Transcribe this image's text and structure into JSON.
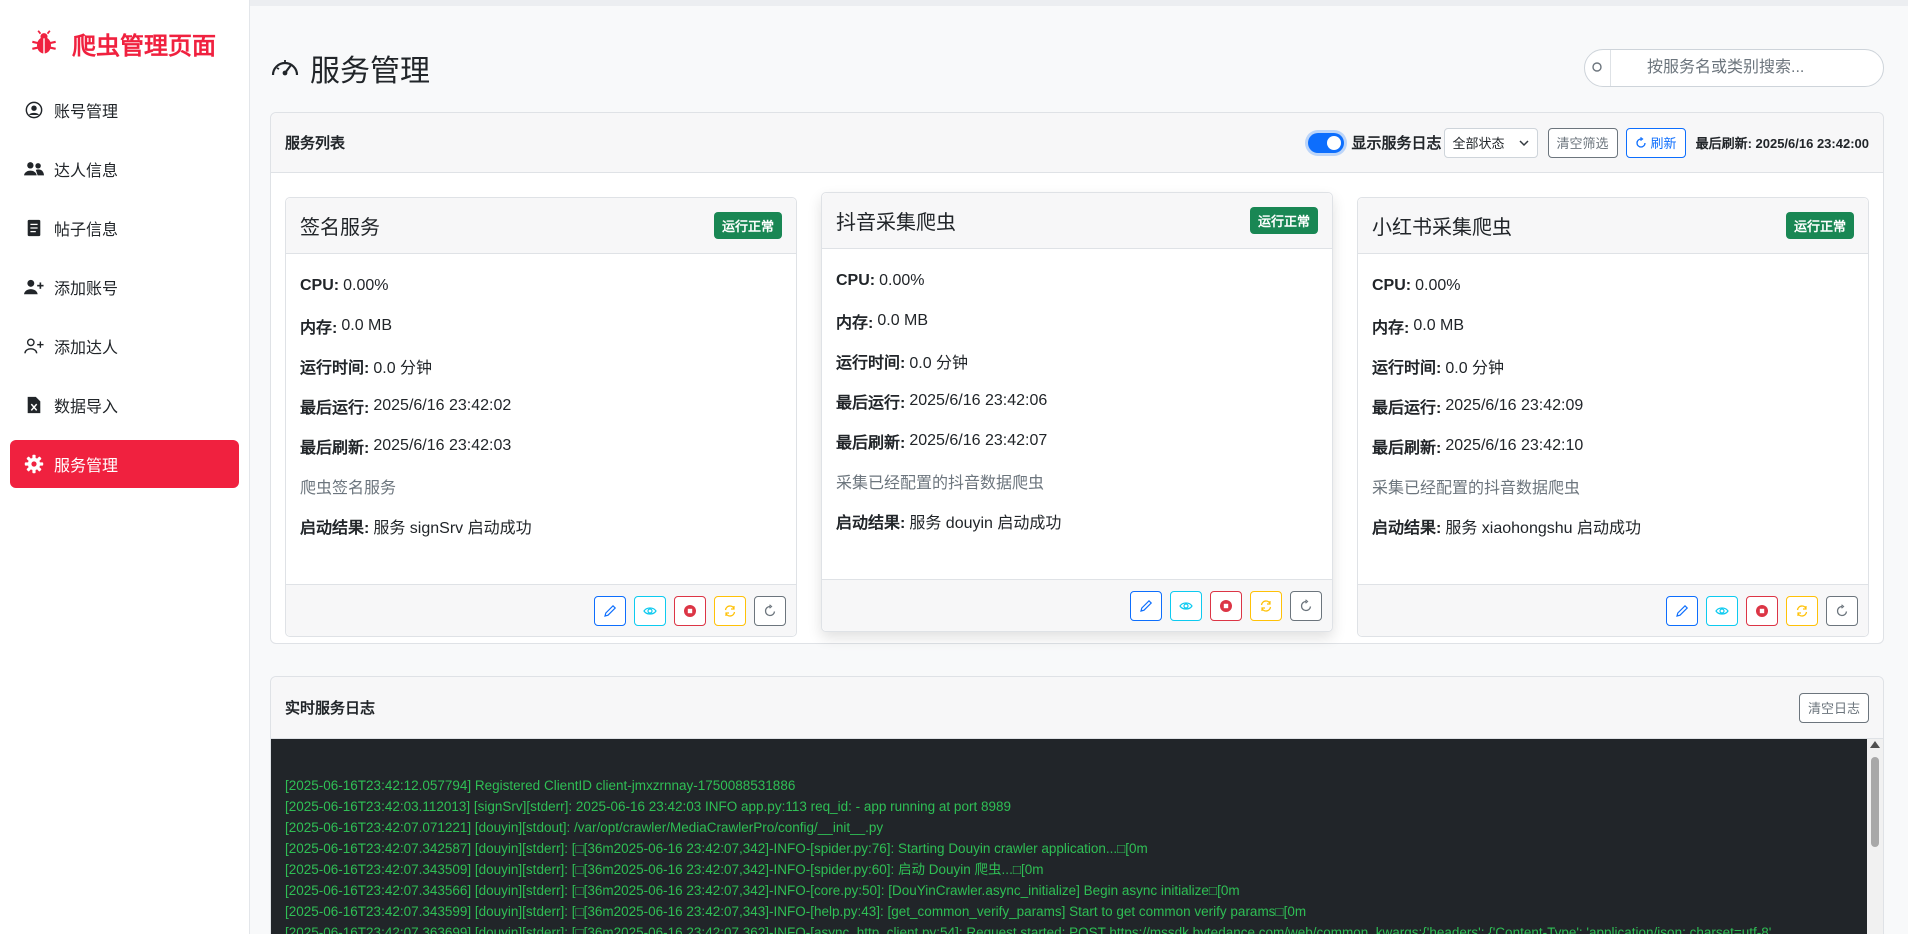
{
  "sidebar": {
    "brand": "爬虫管理页面",
    "items": [
      {
        "label": "账号管理",
        "icon": "user-circle-icon"
      },
      {
        "label": "达人信息",
        "icon": "users-icon"
      },
      {
        "label": "帖子信息",
        "icon": "document-icon"
      },
      {
        "label": "添加账号",
        "icon": "user-plus-icon"
      },
      {
        "label": "添加达人",
        "icon": "user-add-outline-icon"
      },
      {
        "label": "数据导入",
        "icon": "excel-file-icon"
      },
      {
        "label": "服务管理",
        "icon": "gear-icon",
        "active": true
      }
    ]
  },
  "header": {
    "title": "服务管理",
    "search_placeholder": "按服务名或类别搜索..."
  },
  "services_panel": {
    "title": "服务列表",
    "toggle_label": "显示服务日志",
    "toggle_on": true,
    "status_filter": "全部状态",
    "clear_filter_label": "清空筛选",
    "refresh_label": "刷新",
    "last_refresh": "最后刷新: 2025/6/16 23:42:00"
  },
  "labels": {
    "cpu": "CPU:",
    "memory": "内存:",
    "uptime": "运行时间:",
    "last_run": "最后运行:",
    "last_refresh": "最后刷新:",
    "start_result": "启动结果:"
  },
  "services": [
    {
      "name": "签名服务",
      "status": "运行正常",
      "cpu": "0.00%",
      "memory": "0.0 MB",
      "uptime": "0.0 分钟",
      "last_run": "2025/6/16 23:42:02",
      "last_refresh": "2025/6/16 23:42:03",
      "description": "爬虫签名服务",
      "start_result": "服务 signSrv 启动成功"
    },
    {
      "name": "抖音采集爬虫",
      "status": "运行正常",
      "cpu": "0.00%",
      "memory": "0.0 MB",
      "uptime": "0.0 分钟",
      "last_run": "2025/6/16 23:42:06",
      "last_refresh": "2025/6/16 23:42:07",
      "description": "采集已经配置的抖音数据爬虫",
      "start_result": "服务 douyin 启动成功"
    },
    {
      "name": "小红书采集爬虫",
      "status": "运行正常",
      "cpu": "0.00%",
      "memory": "0.0 MB",
      "uptime": "0.0 分钟",
      "last_run": "2025/6/16 23:42:09",
      "last_refresh": "2025/6/16 23:42:10",
      "description": "采集已经配置的抖音数据爬虫",
      "start_result": "服务 xiaohongshu 启动成功"
    }
  ],
  "logs_panel": {
    "title": "实时服务日志",
    "clear_label": "清空日志",
    "lines": [
      "[2025-06-16T23:42:12.057794] Registered ClientID client-jmxzrnnay-1750088531886",
      "[2025-06-16T23:42:03.112013] [signSrv][stderr]: 2025-06-16 23:42:03 INFO app.py:113 req_id: - app running at port 8989",
      "[2025-06-16T23:42:07.071221] [douyin][stdout]: /var/opt/crawler/MediaCrawlerPro/config/__init__.py",
      "[2025-06-16T23:42:07.342587] [douyin][stderr]: [□[36m2025-06-16 23:42:07,342]-INFO-[spider.py:76]: Starting Douyin crawler application...□[0m",
      "[2025-06-16T23:42:07.343509] [douyin][stderr]: [□[36m2025-06-16 23:42:07,342]-INFO-[spider.py:60]: 启动 Douyin 爬虫...□[0m",
      "[2025-06-16T23:42:07.343566] [douyin][stderr]: [□[36m2025-06-16 23:42:07,342]-INFO-[core.py:50]: [DouYinCrawler.async_initialize] Begin async initialize□[0m",
      "[2025-06-16T23:42:07.343599] [douyin][stderr]: [□[36m2025-06-16 23:42:07,343]-INFO-[help.py:43]: [get_common_verify_params] Start to get common verify params□[0m",
      "[2025-06-16T23:42:07.363699] [douyin][stderr]: [□[36m2025-06-16 23:42:07,362]-INFO-[async_http_client.py:54]: Request started: POST https://mssdk.bytedance.com/web/common, kwargs:{'headers': {'Content-Type': 'application/json; charset=utf-8',"
    ]
  },
  "colors": {
    "brand": "#f0213f",
    "success": "#198754",
    "primary": "#0d6efd",
    "log_bg": "#212529",
    "log_text": "#2fbf55"
  }
}
